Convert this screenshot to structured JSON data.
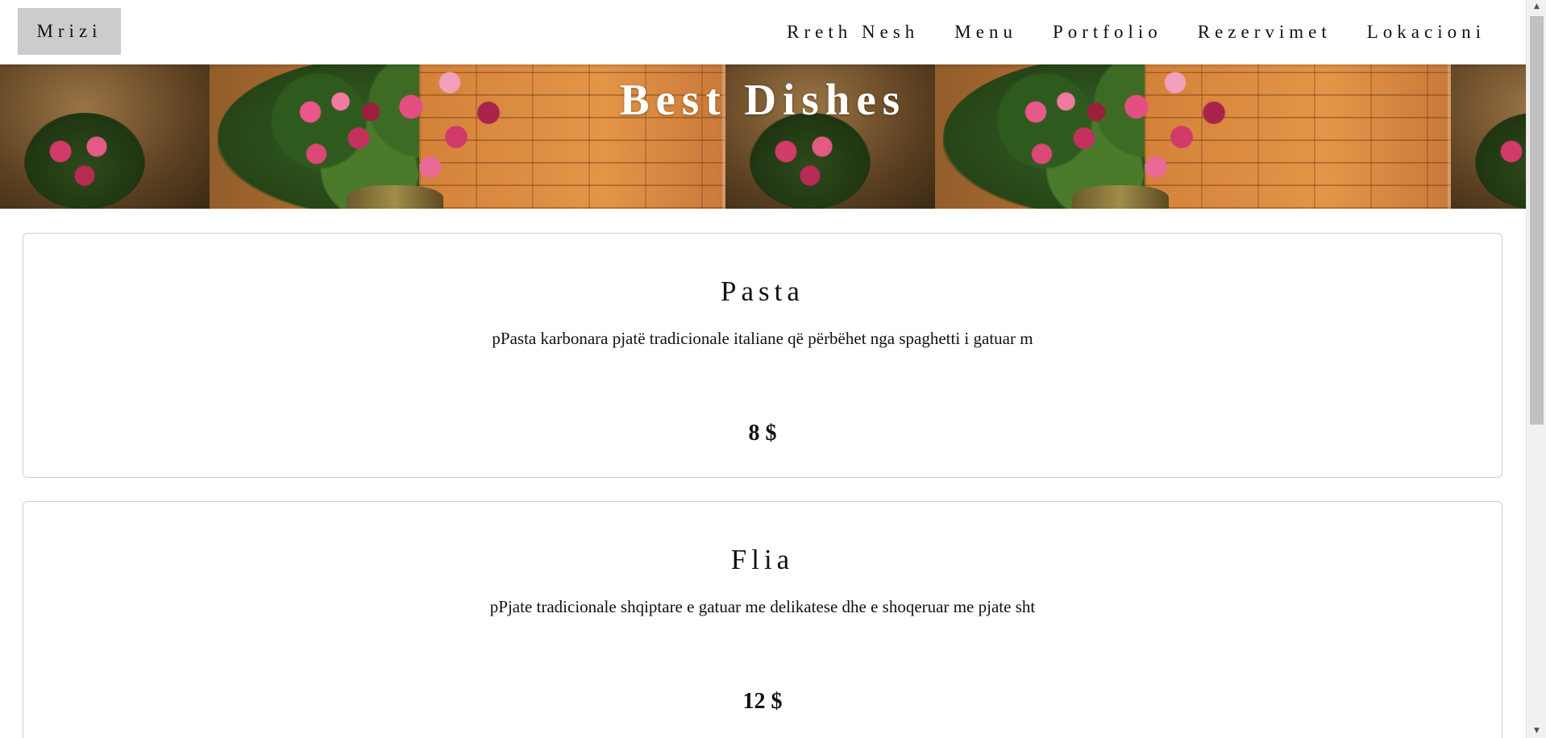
{
  "header": {
    "brand": "Mrizi",
    "nav": [
      {
        "label": "Rreth Nesh"
      },
      {
        "label": "Menu"
      },
      {
        "label": "Portfolio"
      },
      {
        "label": "Rezervimet"
      },
      {
        "label": "Lokacioni"
      }
    ]
  },
  "hero": {
    "title": "Best Dishes"
  },
  "dishes": [
    {
      "name": "Pasta",
      "description": "pPasta karbonara pjatë tradicionale italiane që përbëhet nga spaghetti i gatuar m",
      "price": "8 $"
    },
    {
      "name": "Flia",
      "description": "pPjate tradicionale shqiptare e gatuar me delikatese dhe e shoqeruar me pjate sht",
      "price": "12 $"
    }
  ],
  "scrollbar": {
    "up_icon": "arrow-up-icon",
    "down_icon": "arrow-down-icon"
  }
}
